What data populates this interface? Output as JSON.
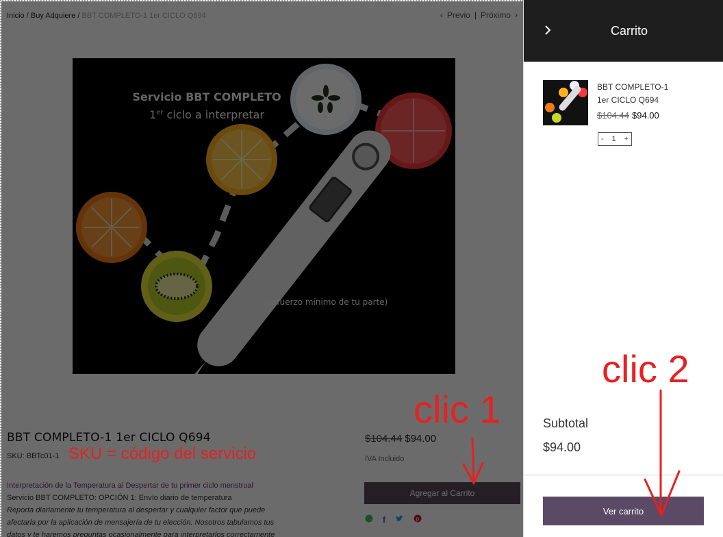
{
  "breadcrumb": {
    "home": "Inicio",
    "section": "Buy Adquiere",
    "current": "BBT COMPLETO-1 1er CICLO Q694",
    "separator": "/"
  },
  "pager": {
    "prev": "Previo",
    "next": "Próximo",
    "separator": "|"
  },
  "product_image": {
    "title_line1": "Servicio BBT COMPLETO",
    "title_line2_prefix": "1",
    "title_line2_sup": "er",
    "title_line2_suffix": " ciclo a interpretar",
    "caption": "(Esfuerzo mínimo de tu parte)"
  },
  "product": {
    "title": "BBT COMPLETO-1 1er CICLO Q694",
    "sku_label": "SKU:",
    "sku_value": "BBTc01-1",
    "price_old": "$104.44",
    "price_new": "$94.00",
    "tax_note": "IVA Incluido",
    "add_to_cart": "Agregar al Carrito",
    "description": [
      "Interpretación de la Temperatura al Despertar de tu primer ciclo menstrual",
      "Servicio BBT COMPLETO: OPCIÓN 1: Envío diario de temperatura",
      "Reporta diariamente tu temperatura al despertar y cualquier factor que puede",
      "afectarla por la aplicación de mensajería de tu elección. Nosotros tabulamos tus",
      "datos y te haremos preguntas ocasionalmente para interpretarlos correctamente"
    ],
    "social_icons": [
      "whatsapp-icon",
      "facebook-icon",
      "twitter-icon",
      "pinterest-icon"
    ]
  },
  "cart": {
    "title": "Carrito",
    "item": {
      "name_line1": "BBT COMPLETO-1",
      "name_line2": "1er CICLO Q694",
      "price_old": "$104.44",
      "price_new": "$94.00",
      "qty": "1",
      "minus": "-",
      "plus": "+"
    },
    "subtotal_label": "Subtotal",
    "subtotal_value": "$94.00",
    "view_cart": "Ver carrito"
  },
  "annotations": {
    "clic1": "clic 1",
    "clic2": "clic 2",
    "sku_note": "SKU = código del servicio"
  },
  "colors": {
    "annotation_red": "#e8201f",
    "button_purple": "#5b4a66",
    "cart_header": "#1e1e1e"
  }
}
